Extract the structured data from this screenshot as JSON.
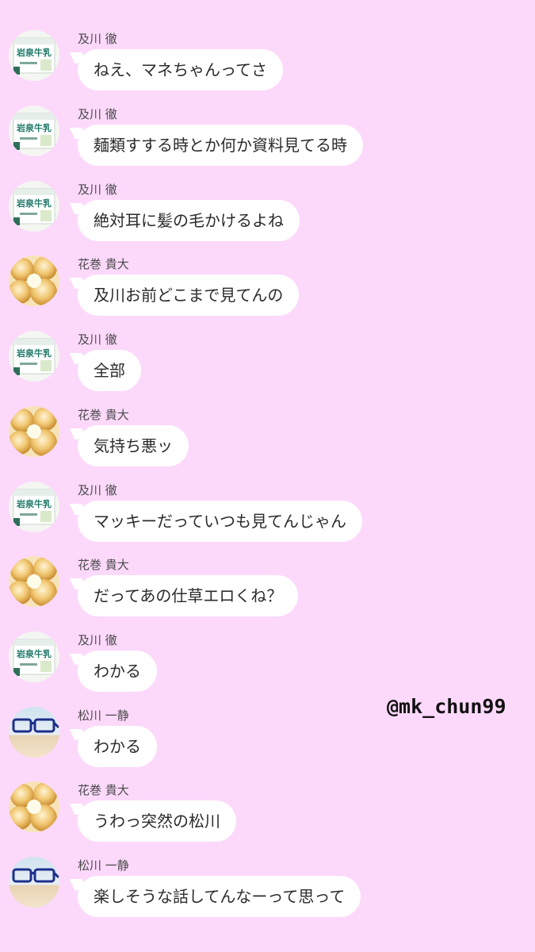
{
  "users": {
    "oikawa": "及川 徹",
    "hanamaki": "花巻 貴大",
    "matsukawa": "松川 一静"
  },
  "avatar_images": {
    "oikawa": {
      "depicts": "milk-bread-package",
      "label_text": "岩泉牛乳"
    },
    "hanamaki": {
      "depicts": "cream-puffs"
    },
    "matsukawa": {
      "depicts": "blue-glasses"
    }
  },
  "messages": [
    {
      "sender": "及川 徹",
      "avatar": "oikawa",
      "text": "ねえ、マネちゃんってさ"
    },
    {
      "sender": "及川 徹",
      "avatar": "oikawa",
      "text": "麺類すする時とか何か資料見てる時"
    },
    {
      "sender": "及川 徹",
      "avatar": "oikawa",
      "text": "絶対耳に髪の毛かけるよね"
    },
    {
      "sender": "花巻 貴大",
      "avatar": "hanamaki",
      "text": "及川お前どこまで見てんの"
    },
    {
      "sender": "及川 徹",
      "avatar": "oikawa",
      "text": "全部"
    },
    {
      "sender": "花巻 貴大",
      "avatar": "hanamaki",
      "text": "気持ち悪ッ"
    },
    {
      "sender": "及川 徹",
      "avatar": "oikawa",
      "text": "マッキーだっていつも見てんじゃん"
    },
    {
      "sender": "花巻 貴大",
      "avatar": "hanamaki",
      "text": "だってあの仕草エロくね？"
    },
    {
      "sender": "及川 徹",
      "avatar": "oikawa",
      "text": "わかる"
    },
    {
      "sender": "松川 一静",
      "avatar": "matsukawa",
      "text": "わかる"
    },
    {
      "sender": "花巻 貴大",
      "avatar": "hanamaki",
      "text": "うわっ突然の松川"
    },
    {
      "sender": "松川 一静",
      "avatar": "matsukawa",
      "text": "楽しそうな話してんなーって思って"
    }
  ],
  "watermark": "@mk_chun99",
  "colors": {
    "background": "#fcd9fb",
    "bubble": "#ffffff",
    "text": "#2b2b2b",
    "sender_text": "#4b4b4b"
  }
}
